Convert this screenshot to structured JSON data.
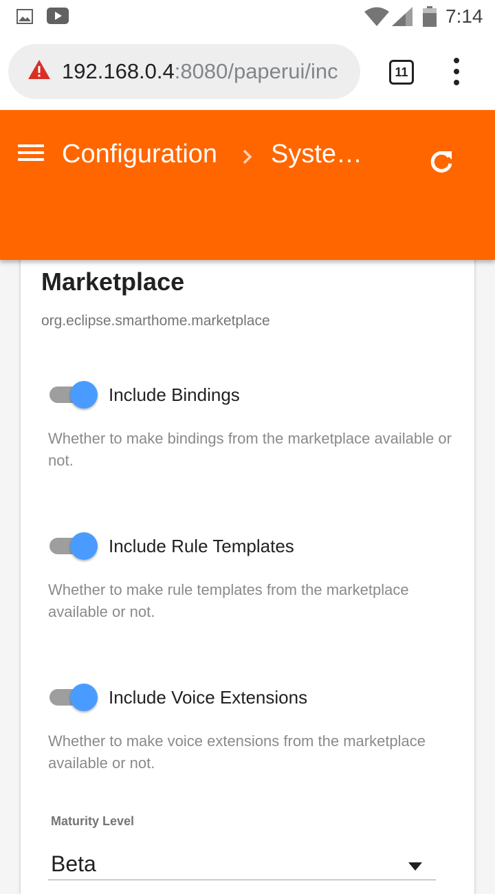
{
  "status_bar": {
    "time": "7:14",
    "icons": [
      "image-icon",
      "youtube-icon",
      "wifi-icon",
      "signal-icon",
      "battery-icon"
    ]
  },
  "browser": {
    "url_host": "192.168.0.4",
    "url_rest": ":8080/paperui/inc",
    "tab_count": "11",
    "warning_color": "#d93025"
  },
  "header": {
    "background_color": "#ff6600",
    "breadcrumb": {
      "root": "Configuration",
      "current": "Syste…"
    }
  },
  "card": {
    "title": "Marketplace",
    "subtitle": "org.eclipse.smarthome.marketplace",
    "toggles": [
      {
        "label": "Include Bindings",
        "description": "Whether to make bindings from the marketplace available or not.",
        "checked": true
      },
      {
        "label": "Include Rule Templates",
        "description": "Whether to make rule templates from the marketplace available or not.",
        "checked": true
      },
      {
        "label": "Include Voice Extensions",
        "description": "Whether to make voice extensions from the marketplace available or not.",
        "checked": true
      }
    ],
    "maturity": {
      "label": "Maturity Level",
      "value": "Beta"
    },
    "toggle_on_color": "#4a9bff"
  }
}
